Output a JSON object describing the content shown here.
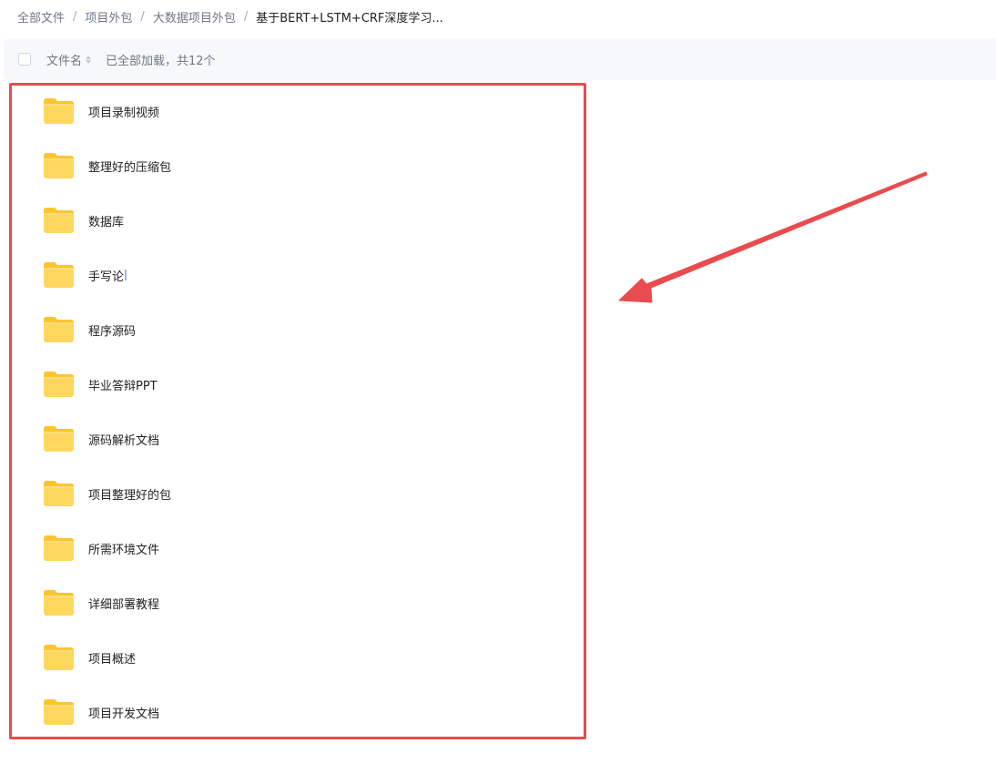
{
  "breadcrumb": {
    "items": [
      "全部文件",
      "项目外包",
      "大数据项目外包"
    ],
    "current": "基于BERT+LSTM+CRF深度学习..."
  },
  "list_header": {
    "column_name": "文件名",
    "load_status": "已全部加载，共12个"
  },
  "files": [
    {
      "name": "项目录制视频",
      "icon": "folder-icon"
    },
    {
      "name": "整理好的压缩包",
      "icon": "folder-icon"
    },
    {
      "name": "数据库",
      "icon": "folder-icon"
    },
    {
      "name": "手写论",
      "icon": "folder-icon"
    },
    {
      "name": "程序源码",
      "icon": "folder-icon"
    },
    {
      "name": "毕业答辩PPT",
      "icon": "folder-icon"
    },
    {
      "name": "源码解析文档",
      "icon": "folder-icon"
    },
    {
      "name": "项目整理好的包",
      "icon": "folder-icon"
    },
    {
      "name": "所需环境文件",
      "icon": "folder-icon"
    },
    {
      "name": "详细部署教程",
      "icon": "folder-icon"
    },
    {
      "name": "项目概述",
      "icon": "folder-icon"
    },
    {
      "name": "项目开发文档",
      "icon": "folder-icon"
    }
  ],
  "colors": {
    "annotation": "#e94b4f",
    "folder_top": "#fbc531",
    "folder_front": "#ffd75e",
    "header_bg": "#f7f8fa"
  }
}
